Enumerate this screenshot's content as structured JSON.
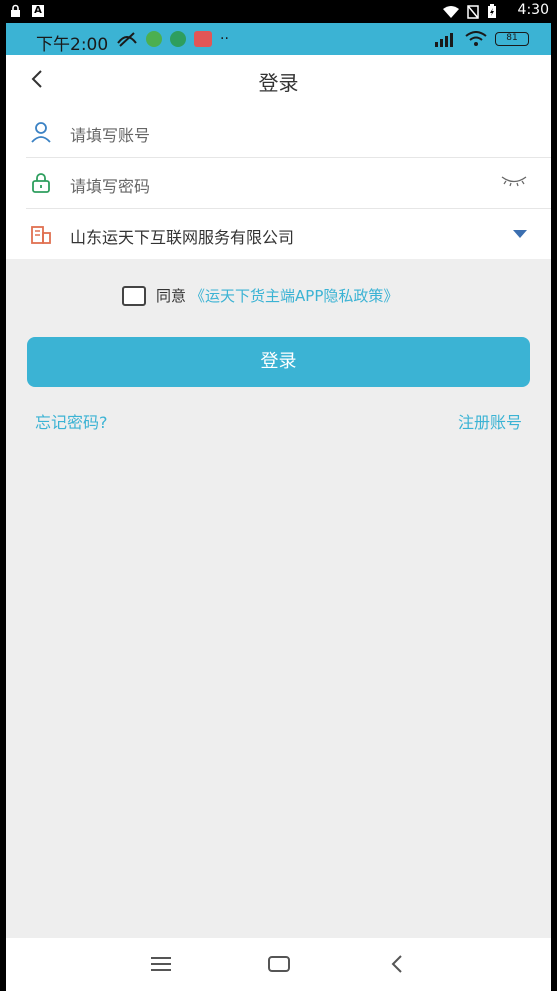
{
  "system_bar": {
    "time": "4:30",
    "a_icon": "A"
  },
  "app_status_bar": {
    "time": "下午2:00",
    "battery": "81",
    "accent_color": "#3bb3d4"
  },
  "header": {
    "title": "登录",
    "back_icon": "chevron-left-icon"
  },
  "form": {
    "account_placeholder": "请填写账号",
    "password_placeholder": "请填写密码",
    "company": "山东运天下互联网服务有限公司"
  },
  "agreement": {
    "prefix": "同意",
    "link": "《运天下货主端APP隐私政策》"
  },
  "login_button": "登录",
  "forgot_password": "忘记密码?",
  "register": "注册账号"
}
